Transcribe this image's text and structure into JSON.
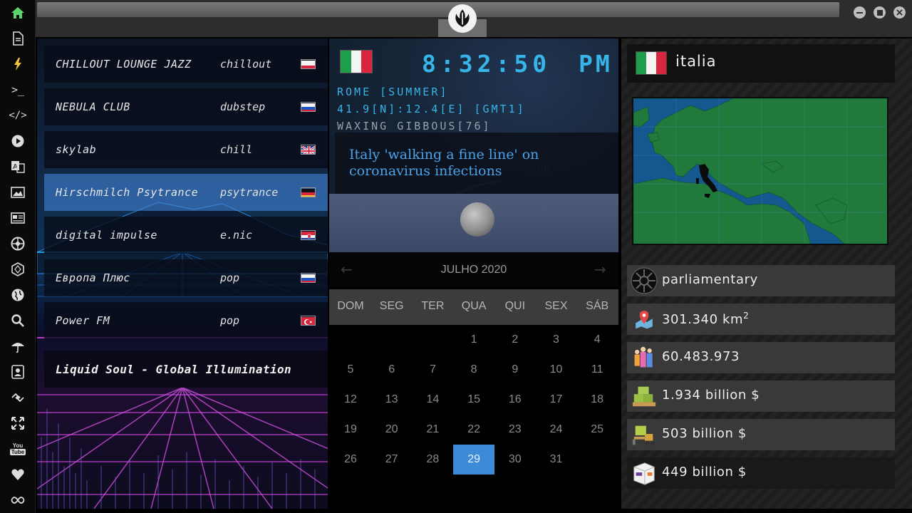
{
  "sidebar": {
    "items": [
      "home-icon",
      "document-icon",
      "lightning-icon",
      "terminal-icon",
      "code-icon",
      "play-icon",
      "translate-icon",
      "image-icon",
      "news-icon",
      "empire-icon",
      "hexagon-icon",
      "globe-icon",
      "search-icon",
      "umbrella-icon",
      "contact-icon",
      "link-icon",
      "expand-icon",
      "youtube-icon",
      "heart-icon",
      "infinity-icon"
    ],
    "youtube_text": "You\nTube"
  },
  "radio": {
    "stations": [
      {
        "name": "CHILLOUT LOUNGE JAZZ",
        "genre": "chillout",
        "flag": "PL"
      },
      {
        "name": "NEBULA CLUB",
        "genre": "dubstep",
        "flag": "RU"
      },
      {
        "name": "skylab",
        "genre": "chill",
        "flag": "GB"
      },
      {
        "name": "Hirschmilch Psytrance",
        "genre": "psytrance",
        "flag": "DE"
      },
      {
        "name": "digital impulse",
        "genre": "e.nic",
        "flag": "HR"
      },
      {
        "name": "Европа Плюс",
        "genre": "pop",
        "flag": "RU"
      },
      {
        "name": "Power FM",
        "genre": "pop",
        "flag": "TR"
      }
    ],
    "active_index": 3,
    "now_playing": "Liquid Soul - Global Illumination"
  },
  "clock": {
    "time": "8:32:50",
    "ampm": "PM",
    "city": "ROME [SUMMER]",
    "coords": "41.9[N]:12.4[E] [GMT1]",
    "moon": "WAXING GIBBOUS[76]"
  },
  "news": {
    "headline": "Italy 'walking a fine line' on coronavirus infections"
  },
  "calendar": {
    "month_label": "JULHO 2020",
    "weekdays": [
      "DOM",
      "SEG",
      "TER",
      "QUA",
      "QUI",
      "SEX",
      "SÁB"
    ],
    "first_weekday": 3,
    "days_in_month": 31,
    "today": 29
  },
  "country": {
    "name": "italia",
    "government": "parliamentary",
    "area": "301.340 km",
    "area_unit_sup": "2",
    "population": "60.483.973",
    "gdp": "1.934 billion $",
    "imports": "503 billion $",
    "exports": "449 billion $"
  },
  "colors": {
    "accent": "#37b4e8",
    "today": "#3d8bd6",
    "active_station": "#4c8ce0",
    "map_ocean": "#14588f",
    "map_land": "#1f7a3c"
  }
}
